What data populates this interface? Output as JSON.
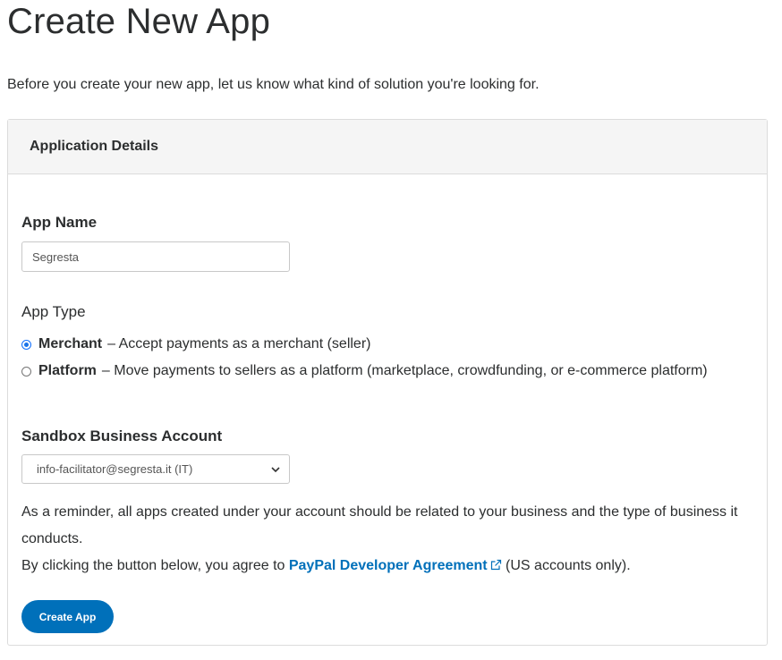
{
  "page": {
    "title": "Create New App",
    "intro": "Before you create your new app, let us know what kind of solution you're looking for."
  },
  "card": {
    "header": "Application Details",
    "app_name": {
      "label": "App Name",
      "value": "Segresta"
    },
    "app_type": {
      "label": "App Type",
      "options": [
        {
          "name": "Merchant",
          "description": "– Accept payments as a merchant (seller)",
          "checked": true
        },
        {
          "name": "Platform",
          "description": "– Move payments to sellers as a platform (marketplace, crowdfunding, or e-commerce platform)",
          "checked": false
        }
      ]
    },
    "sandbox": {
      "label": "Sandbox Business Account",
      "selected": "info-facilitator@segresta.it (IT)"
    },
    "reminder": "As a reminder, all apps created under your account should be related to your business and the type of business it conducts.",
    "agreement": {
      "prefix": "By clicking the button below, you agree to",
      "link": "PayPal Developer Agreement",
      "suffix": "(US accounts only)."
    },
    "create_button": "Create App"
  },
  "colors": {
    "accent": "#0070ba",
    "header_bg": "#f5f5f5",
    "border": "#dcdcdc",
    "text": "#2c2e2f"
  },
  "icons": {
    "external_link": "external-link-icon",
    "select_arrow": "chevron-down-icon"
  }
}
